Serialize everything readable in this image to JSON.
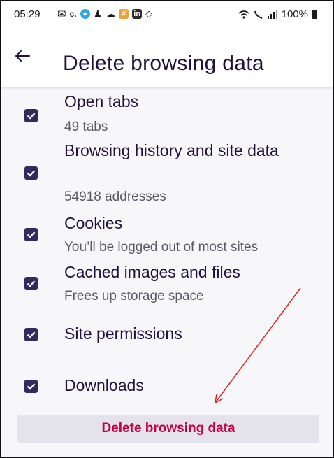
{
  "status_bar": {
    "time": "05:29",
    "battery": "100%"
  },
  "toolbar": {
    "back_icon": "arrow-left-icon",
    "title": "Delete browsing data"
  },
  "items": [
    {
      "title": "Open tabs",
      "subtitle": "49 tabs",
      "checked": true
    },
    {
      "title": "Browsing history and site data",
      "subtitle": "54918 addresses",
      "checked": true
    },
    {
      "title": "Cookies",
      "subtitle": "You’ll be logged out of most sites",
      "checked": true
    },
    {
      "title": "Cached images and files",
      "subtitle": "Frees up storage space",
      "checked": true
    },
    {
      "title": "Site permissions",
      "subtitle": "",
      "checked": true
    },
    {
      "title": "Downloads",
      "subtitle": "",
      "checked": true
    }
  ],
  "delete_button": {
    "label": "Delete browsing data"
  },
  "colors": {
    "accent": "#c50042",
    "checkbox": "#2f2a5f",
    "annotation_arrow": "#e02020"
  }
}
